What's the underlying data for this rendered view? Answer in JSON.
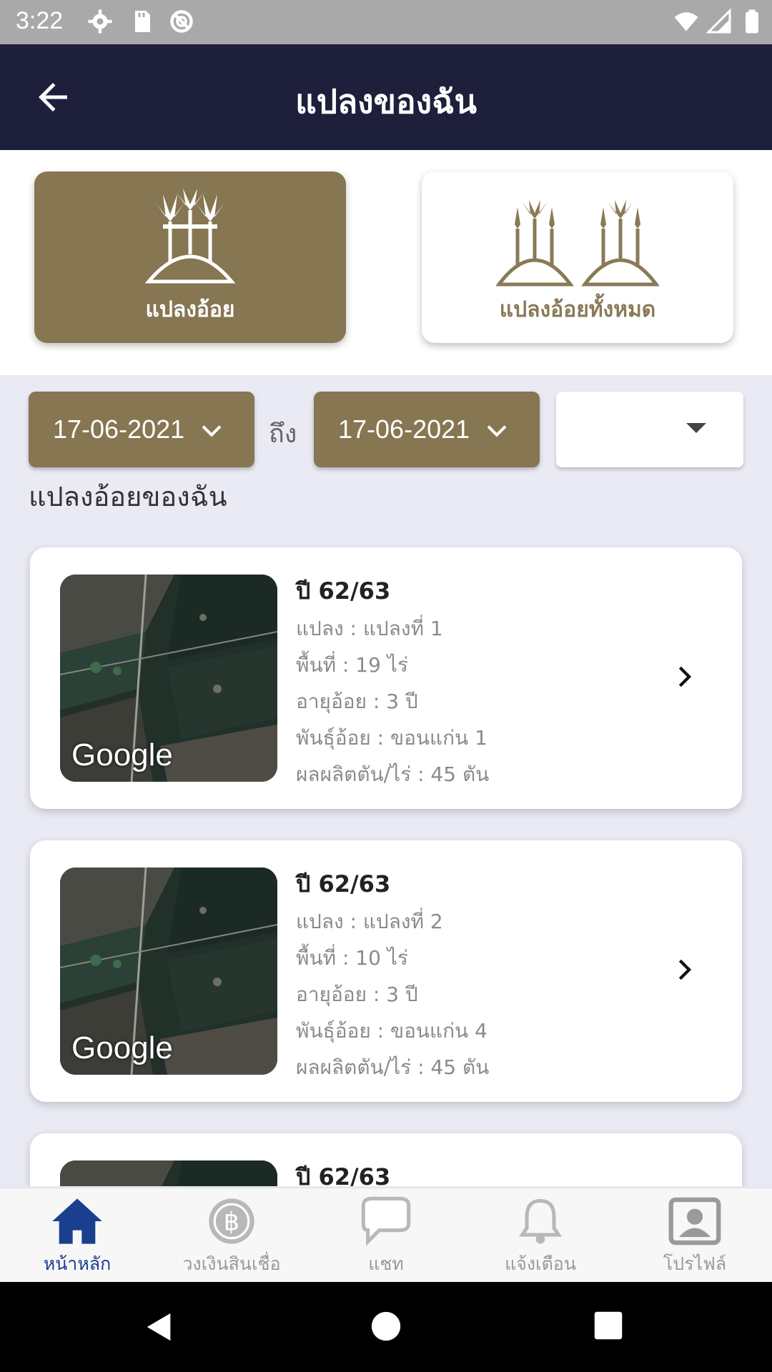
{
  "status_bar": {
    "time": "3:22"
  },
  "app_bar": {
    "title": "แปลงของฉัน"
  },
  "toggles": [
    {
      "label": "แปลงอ้อย",
      "active": true
    },
    {
      "label": "แปลงอ้อยทั้งหมด",
      "active": false
    }
  ],
  "filters": {
    "date_from": "17-06-2021",
    "to_label": "ถึง",
    "date_to": "17-06-2021",
    "select_value": ""
  },
  "section_title": "แปลงอ้อยของฉัน",
  "cards": [
    {
      "year": "ปี 62/63",
      "plot": "แปลง : แปลงที่ 1",
      "area": "พื้นที่ : 19 ไร่",
      "age": "อายุอ้อย : 3 ปี",
      "variety": "พันธุ์อ้อย : ขอนแก่น 1",
      "yield": "ผลผลิตตัน/ไร่ : 45 ตัน",
      "map_attribution": "Google"
    },
    {
      "year": "ปี 62/63",
      "plot": "แปลง : แปลงที่ 2",
      "area": "พื้นที่ : 10 ไร่",
      "age": "อายุอ้อย : 3 ปี",
      "variety": "พันธุ์อ้อย : ขอนแก่น 4",
      "yield": "ผลผลิตตัน/ไร่ : 45 ตัน",
      "map_attribution": "Google"
    },
    {
      "year": "ปี 62/63",
      "plot": "",
      "area": "",
      "age": "",
      "variety": "",
      "yield": "",
      "map_attribution": ""
    }
  ],
  "bottom_nav": [
    {
      "label": "หน้าหลัก",
      "icon": "home-icon",
      "active": true
    },
    {
      "label": "วงเงินสินเชื่อ",
      "icon": "baht-coin-icon",
      "active": false
    },
    {
      "label": "แชท",
      "icon": "chat-icon",
      "active": false
    },
    {
      "label": "แจ้งเตือน",
      "icon": "bell-icon",
      "active": false
    },
    {
      "label": "โปรไฟล์",
      "icon": "profile-icon",
      "active": false
    }
  ],
  "colors": {
    "app_bar": "#1e1f3b",
    "accent_gold": "#867651",
    "active_nav": "#1b3f8f",
    "background": "#e9eaf4"
  }
}
